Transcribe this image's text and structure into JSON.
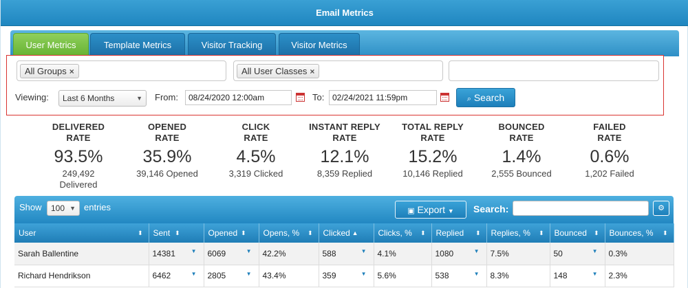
{
  "window": {
    "title": "Email Metrics"
  },
  "tabs": [
    {
      "label": "User Metrics",
      "active": true
    },
    {
      "label": "Template Metrics",
      "active": false
    },
    {
      "label": "Visitor Tracking",
      "active": false
    },
    {
      "label": "Visitor Metrics",
      "active": false
    }
  ],
  "filters": {
    "groups_chip": "All Groups",
    "classes_chip": "All User Classes",
    "chip_remove": "×",
    "viewing_label": "Viewing:",
    "viewing_value": "Last 6 Months",
    "from_label": "From:",
    "from_value": "08/24/2020 12:00am",
    "to_label": "To:",
    "to_value": "02/24/2021 11:59pm",
    "search_button": "Search",
    "search_icon": "search-icon",
    "calendar_icon": "calendar-icon"
  },
  "metrics": [
    {
      "title_line1": "DELIVERED",
      "title_line2": "RATE",
      "value": "93.5%",
      "detail_line1": "249,492",
      "detail_line2": "Delivered"
    },
    {
      "title_line1": "OPENED",
      "title_line2": "RATE",
      "value": "35.9%",
      "detail_line1": "39,146 Opened",
      "detail_line2": ""
    },
    {
      "title_line1": "CLICK",
      "title_line2": "RATE",
      "value": "4.5%",
      "detail_line1": "3,319 Clicked",
      "detail_line2": ""
    },
    {
      "title_line1": "INSTANT REPLY",
      "title_line2": "RATE",
      "value": "12.1%",
      "detail_line1": "8,359 Replied",
      "detail_line2": ""
    },
    {
      "title_line1": "TOTAL REPLY",
      "title_line2": "RATE",
      "value": "15.2%",
      "detail_line1": "10,146 Replied",
      "detail_line2": ""
    },
    {
      "title_line1": "BOUNCED",
      "title_line2": "RATE",
      "value": "1.4%",
      "detail_line1": "2,555 Bounced",
      "detail_line2": ""
    },
    {
      "title_line1": "FAILED",
      "title_line2": "RATE",
      "value": "0.6%",
      "detail_line1": "1,202 Failed",
      "detail_line2": ""
    }
  ],
  "table": {
    "show_label": "Show",
    "entries_value": "100",
    "entries_label": "entries",
    "export_label": "Export",
    "search_label": "Search:",
    "search_value": "",
    "columns": [
      "User",
      "Sent",
      "Opened",
      "Opens, %",
      "Clicked",
      "Clicks, %",
      "Replied",
      "Replies, %",
      "Bounced",
      "Bounces, %"
    ],
    "sort_icons": [
      "⬍",
      "⬍",
      "⬍",
      "⬍",
      "▲",
      "⬍",
      "⬍",
      "⬍",
      "⬍",
      "⬍"
    ],
    "rows": [
      [
        "Sarah Ballentine",
        "14381",
        "6069",
        "42.2%",
        "588",
        "4.1%",
        "1080",
        "7.5%",
        "50",
        "0.3%"
      ],
      [
        "Richard Hendrikson",
        "6462",
        "2805",
        "43.4%",
        "359",
        "5.6%",
        "538",
        "8.3%",
        "148",
        "2.3%"
      ]
    ]
  },
  "colors": {
    "header_blue": "#1f86c0",
    "tab_active_green": "#66b232",
    "filter_border_red": "#d9322f"
  }
}
